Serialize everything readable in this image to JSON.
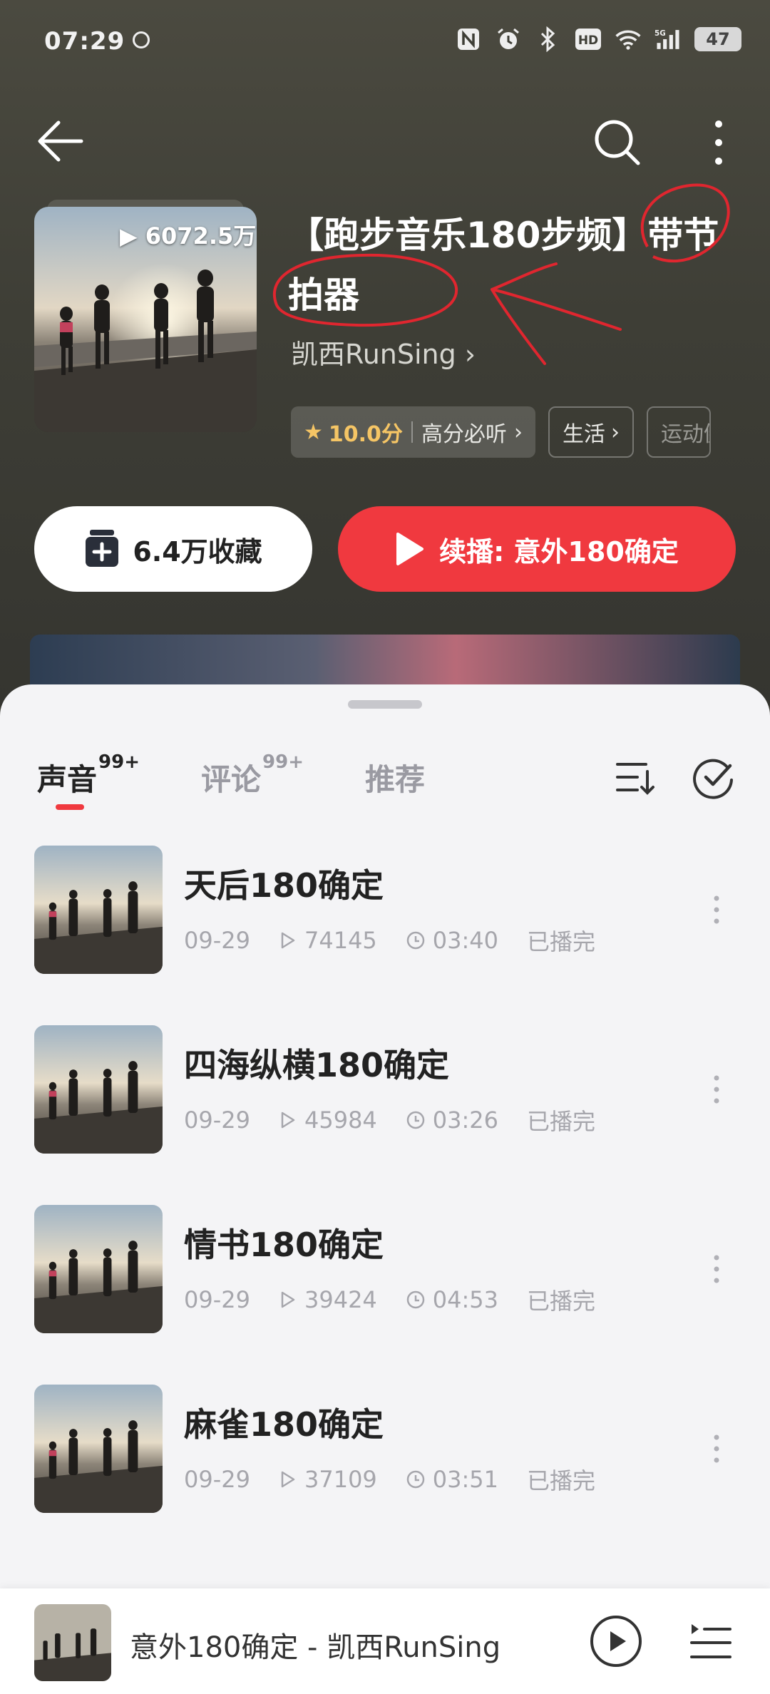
{
  "status": {
    "time": "07:29",
    "battery": "47",
    "icons": [
      "nfc-icon",
      "alarm-icon",
      "bluetooth-icon",
      "hd-icon",
      "wifi-icon",
      "signal-5g-icon"
    ]
  },
  "album": {
    "play_count": "6072.5万",
    "title": "【跑步音乐180步频】带节拍器",
    "author": "凯西RunSing",
    "score": "10.0分",
    "score_tag": "高分必听",
    "tags": [
      "生活",
      "运动健"
    ]
  },
  "actions": {
    "favorite_label": "6.4万收藏",
    "continue_label": "续播: 意外180确定"
  },
  "tabs": [
    {
      "label": "声音",
      "badge": "99+"
    },
    {
      "label": "评论",
      "badge": "99+"
    },
    {
      "label": "推荐",
      "badge": ""
    }
  ],
  "tracks": [
    {
      "name": "天后180确定",
      "date": "09-29",
      "plays": "74145",
      "duration": "03:40",
      "status": "已播完"
    },
    {
      "name": "四海纵横180确定",
      "date": "09-29",
      "plays": "45984",
      "duration": "03:26",
      "status": "已播完"
    },
    {
      "name": "情书180确定",
      "date": "09-29",
      "plays": "39424",
      "duration": "04:53",
      "status": "已播完"
    },
    {
      "name": "麻雀180确定",
      "date": "09-29",
      "plays": "37109",
      "duration": "03:51",
      "status": "已播完"
    }
  ],
  "player": {
    "now_playing": "意外180确定 - 凯西RunSing"
  },
  "colors": {
    "accent": "#f0393f",
    "score": "#f5c565",
    "annotation": "#e0262f"
  }
}
